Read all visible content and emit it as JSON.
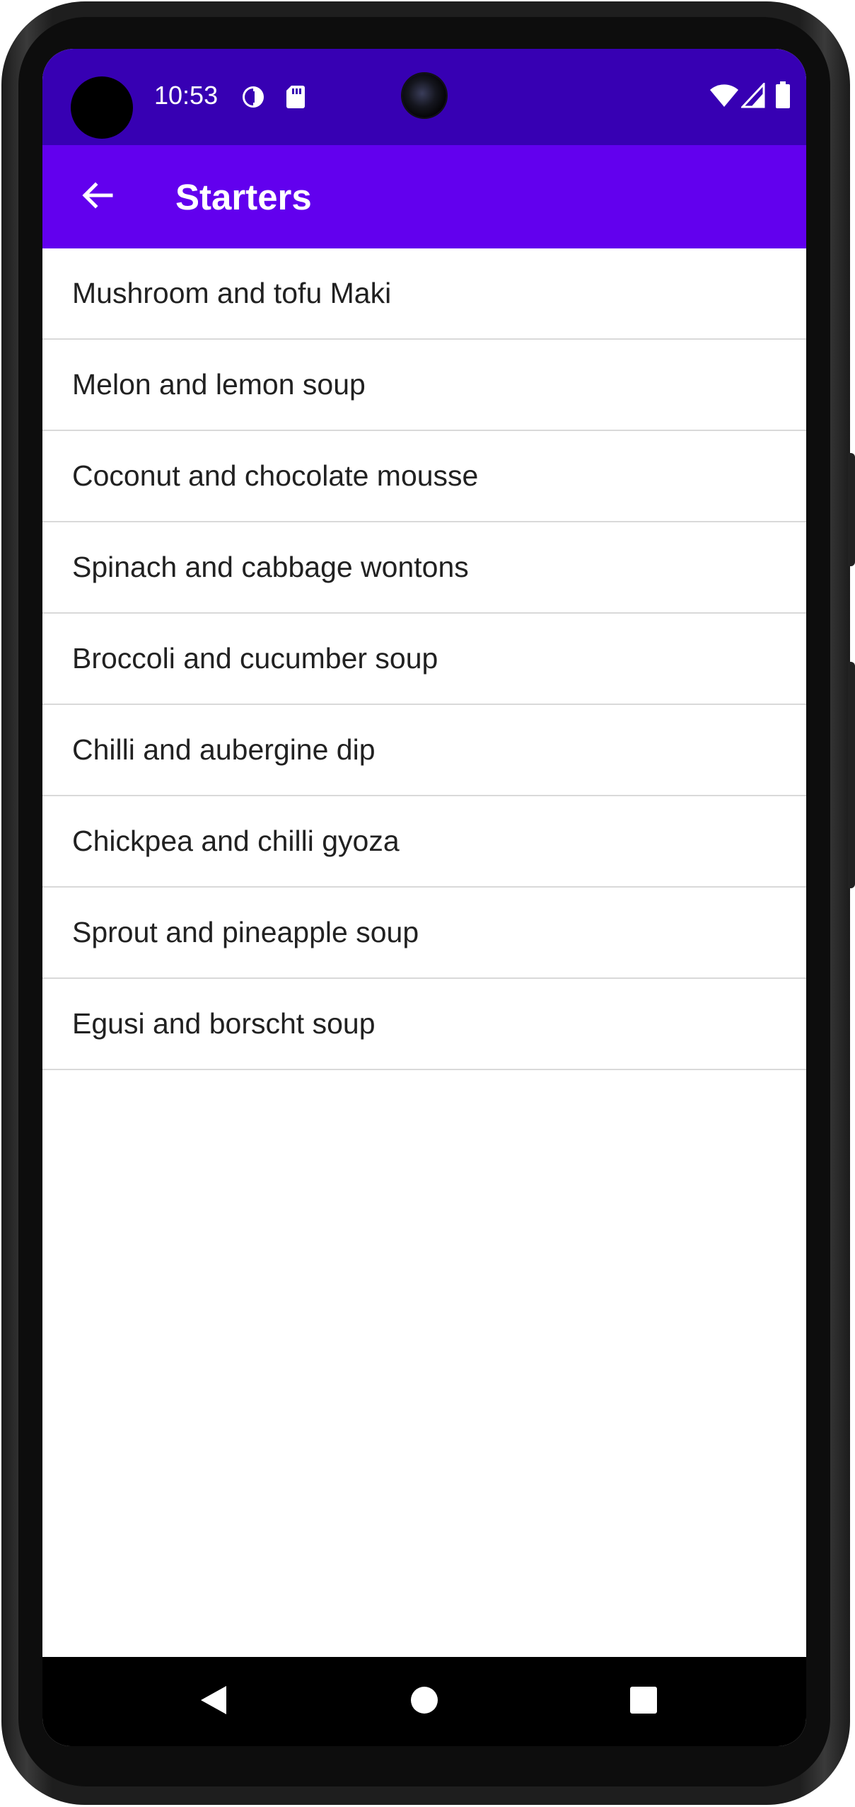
{
  "status_bar": {
    "time": "10:53",
    "icons": [
      "data-saver-icon",
      "sd-card-icon",
      "wifi-icon",
      "cellular-signal-icon",
      "battery-icon"
    ],
    "color": "#3700b3"
  },
  "app_bar": {
    "title": "Starters",
    "back_icon": "arrow-back-icon",
    "color": "#6200ee"
  },
  "list": {
    "items": [
      {
        "label": "Mushroom and tofu Maki"
      },
      {
        "label": "Melon and lemon soup"
      },
      {
        "label": "Coconut and chocolate mousse"
      },
      {
        "label": "Spinach and cabbage wontons"
      },
      {
        "label": "Broccoli and cucumber soup"
      },
      {
        "label": "Chilli and aubergine dip"
      },
      {
        "label": "Chickpea and chilli gyoza"
      },
      {
        "label": "Sprout and pineapple soup"
      },
      {
        "label": "Egusi and borscht soup"
      }
    ]
  },
  "nav_bar": {
    "buttons": [
      "back-triangle-icon",
      "home-circle-icon",
      "recents-square-icon"
    ]
  }
}
